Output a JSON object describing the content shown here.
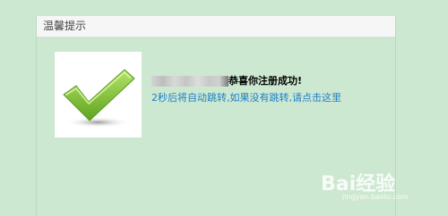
{
  "dialog": {
    "title": "温馨提示",
    "success_message": "恭喜你注册成功!",
    "redirect_text": "2秒后将自动跳转,如果没有跳转,请点击这里"
  },
  "icons": {
    "success": "check-mark-icon"
  },
  "watermark": {
    "brand": "Bai经验",
    "url": "jingyan.baidu.com"
  },
  "colors": {
    "background": "#cde8d0",
    "link": "#1e7fc9",
    "check_green": "#7cc633"
  }
}
